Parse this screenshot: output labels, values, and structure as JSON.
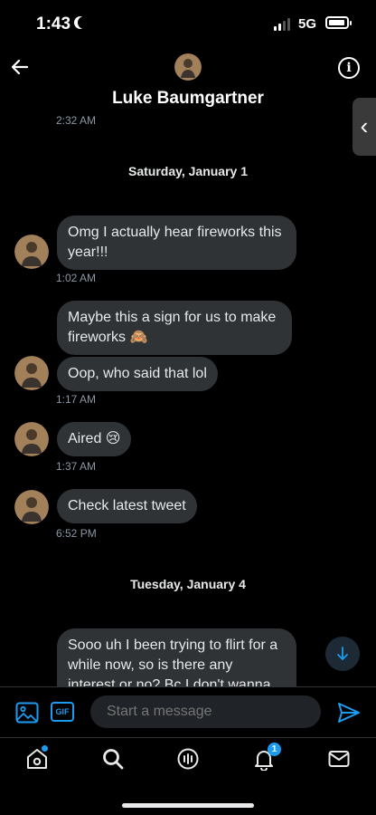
{
  "status_bar": {
    "time": "1:43",
    "network": "5G"
  },
  "header": {
    "contact_name": "Luke Baumgartner"
  },
  "conversation": {
    "first_timestamp": "2:32 AM",
    "date_separator_1": "Saturday, January 1",
    "messages": [
      {
        "text": "Omg I actually hear fireworks this\nyear!!!",
        "time": "1:02 AM"
      },
      {
        "text": "Maybe this a sign for us to make\nfireworks 🙈"
      },
      {
        "text": "Oop, who said that lol",
        "time": "1:17 AM"
      },
      {
        "text": "Aired 😢",
        "time": "1:37 AM"
      },
      {
        "text": "Check latest tweet",
        "time": "6:52 PM"
      }
    ],
    "date_separator_2": "Tuesday, January 4",
    "last_message": "Sooo uh I been trying to flirt for a\nwhile now, so is there any\ninterest or no? Bc I don't wanna"
  },
  "composer": {
    "gif_label": "GIF",
    "placeholder": "Start a message"
  },
  "tabbar": {
    "notifications_count": "1"
  },
  "colors": {
    "accent": "#1d9bf0",
    "bubble": "#2f3336",
    "background": "#000000"
  },
  "icons": [
    "back-arrow-icon",
    "info-icon",
    "image-icon",
    "gif-icon",
    "send-icon",
    "home-icon",
    "search-icon",
    "spaces-icon",
    "bell-icon",
    "mail-icon",
    "arrow-down-icon"
  ]
}
